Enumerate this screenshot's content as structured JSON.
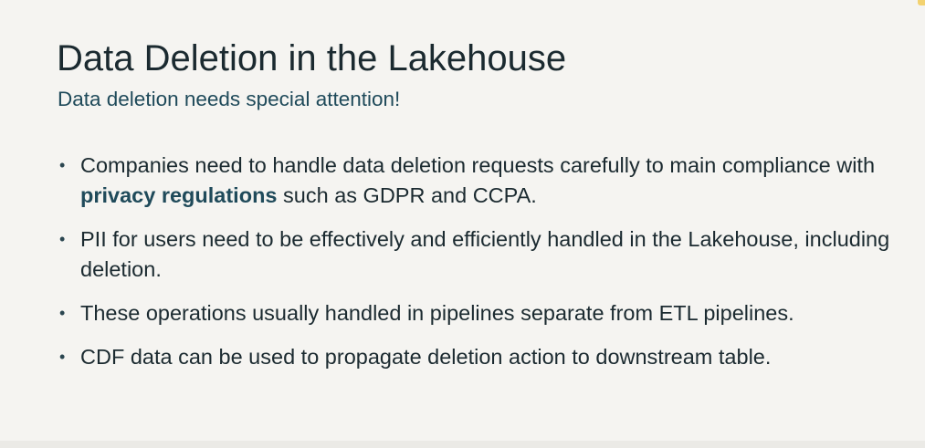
{
  "slide": {
    "title": "Data Deletion in the Lakehouse",
    "subtitle": "Data deletion needs special attention!",
    "bullets": [
      {
        "before": "Companies need to handle data deletion requests carefully to main compliance with ",
        "emphasis": "privacy regulations",
        "after": " such as GDPR and CCPA."
      },
      {
        "text": "PII for users need to be effectively and efficiently handled in the Lakehouse, including deletion."
      },
      {
        "text": "These operations usually handled in pipelines separate from ETL pipelines."
      },
      {
        "text": "CDF data can be used to propagate deletion action to downstream table."
      }
    ],
    "bullet_glyph": "•"
  },
  "colors": {
    "background": "#f5f4f1",
    "title": "#1b2a30",
    "subtitle": "#1f4a5a",
    "emphasis": "#1f4a5a"
  }
}
